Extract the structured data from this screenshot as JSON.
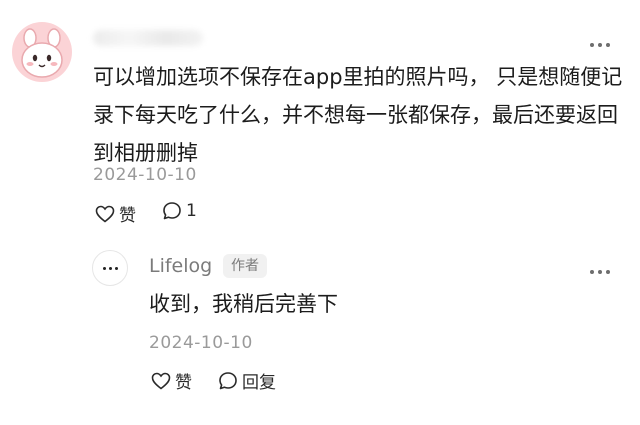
{
  "comment": {
    "text": "可以增加选项不保存在app里拍的照片吗， 只是想随便记录下每天吃了什么，并不想每一张都保存，最后还要返回到相册删掉",
    "date": "2024-10-10",
    "like_label": "赞",
    "reply_count": "1",
    "avatar_icon": "bunny-avatar-icon"
  },
  "reply": {
    "author": "Lifelog",
    "author_badge": "作者",
    "text": "收到，我稍后完善下",
    "date": "2024-10-10",
    "like_label": "赞",
    "reply_label": "回复"
  },
  "colors": {
    "text": "#1c1c1c",
    "muted": "#9a9a9a",
    "avatar_bg": "#fbd3d6",
    "badge_bg": "#f1f1f1"
  }
}
